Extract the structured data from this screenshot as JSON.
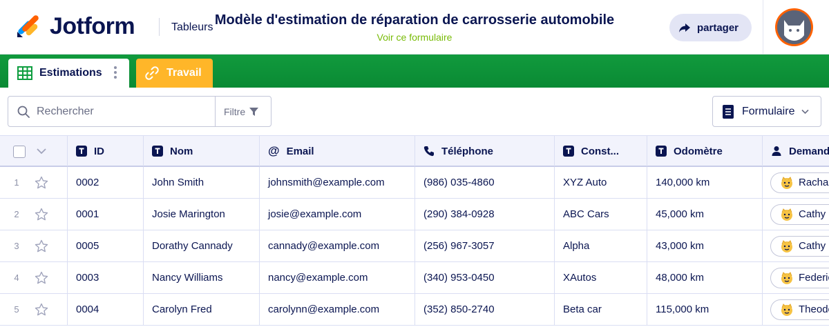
{
  "app": {
    "brand": "Jotform",
    "section": "Tableurs",
    "title": "Modèle d'estimation de réparation de carrosserie automobile",
    "view_form_link": "Voir ce formulaire",
    "share_label": "partager",
    "avatar_icon": "user-avatar-icon"
  },
  "tabs": [
    {
      "label": "Estimations",
      "icon": "grid-icon",
      "active": true
    },
    {
      "label": "Travail",
      "icon": "link-icon",
      "active": false
    }
  ],
  "toolbar": {
    "search_placeholder": "Rechercher",
    "filter_label": "Filtre",
    "form_button_label": "Formulaire"
  },
  "table": {
    "columns": [
      {
        "label": "ID",
        "icon": "text-field-icon"
      },
      {
        "label": "Nom",
        "icon": "text-field-icon"
      },
      {
        "label": "Email",
        "icon": "at-sign-icon"
      },
      {
        "label": "Téléphone",
        "icon": "phone-icon"
      },
      {
        "label": "Const...",
        "icon": "text-field-icon"
      },
      {
        "label": "Odomètre",
        "icon": "text-field-icon"
      },
      {
        "label": "Demand",
        "icon": "user-icon"
      }
    ],
    "rows": [
      {
        "num": "1",
        "id": "0002",
        "nom": "John Smith",
        "email": "johnsmith@example.com",
        "tel": "(986) 035-4860",
        "const": "XYZ Auto",
        "odo": "140,000 km",
        "demand": "Rachae"
      },
      {
        "num": "2",
        "id": "0001",
        "nom": "Josie Marington",
        "email": "josie@example.com",
        "tel": "(290) 384-0928",
        "const": "ABC Cars",
        "odo": "45,000 km",
        "demand": "Cathy F"
      },
      {
        "num": "3",
        "id": "0005",
        "nom": "Dorathy Cannady",
        "email": "cannady@example.com",
        "tel": "(256) 967-3057",
        "const": "Alpha",
        "odo": "43,000 km",
        "demand": "Cathy F"
      },
      {
        "num": "4",
        "id": "0003",
        "nom": "Nancy Williams",
        "email": "nancy@example.com",
        "tel": "(340) 953-0450",
        "const": "XAutos",
        "odo": "48,000 km",
        "demand": "Federic"
      },
      {
        "num": "5",
        "id": "0004",
        "nom": "Carolyn Fred",
        "email": "carolynn@example.com",
        "tel": "(352) 850-2740",
        "const": "Beta car",
        "odo": "115,000 km",
        "demand": "Theodo"
      }
    ]
  },
  "colors": {
    "navy": "#0a1551",
    "green_bar": "#0d9d3e",
    "orange_tab": "#ffb629",
    "link_green": "#78bb07",
    "avatar_ring": "#ff6100"
  }
}
